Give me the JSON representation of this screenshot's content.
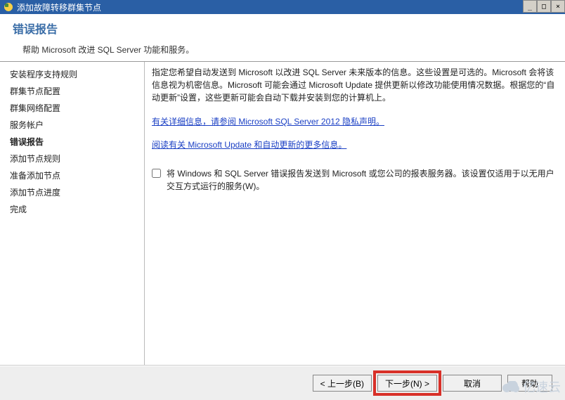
{
  "window": {
    "title": "添加故障转移群集节点",
    "minimize": "_",
    "maximize": "□",
    "close": "×"
  },
  "header": {
    "title": "错误报告",
    "subtitle": "帮助 Microsoft 改进 SQL Server 功能和服务。"
  },
  "sidebar": {
    "items": [
      {
        "label": "安装程序支持规则",
        "active": false
      },
      {
        "label": "群集节点配置",
        "active": false
      },
      {
        "label": "群集网络配置",
        "active": false
      },
      {
        "label": "服务帐户",
        "active": false
      },
      {
        "label": "错误报告",
        "active": true
      },
      {
        "label": "添加节点规则",
        "active": false
      },
      {
        "label": "准备添加节点",
        "active": false
      },
      {
        "label": "添加节点进度",
        "active": false
      },
      {
        "label": "完成",
        "active": false
      }
    ]
  },
  "main": {
    "description": "指定您希望自动发送到 Microsoft 以改进 SQL Server 未来版本的信息。这些设置是可选的。Microsoft 会将该信息视为机密信息。Microsoft 可能会通过 Microsoft Update 提供更新以修改功能使用情况数据。根据您的“自动更新”设置，这些更新可能会自动下载并安装到您的计算机上。",
    "link1": "有关详细信息，请参阅 Microsoft SQL Server 2012 隐私声明。",
    "link2": "阅读有关 Microsoft Update 和自动更新的更多信息。",
    "checkbox_label": "将 Windows 和 SQL Server 错误报告发送到 Microsoft 或您公司的报表服务器。该设置仅适用于以无用户交互方式运行的服务(W)。",
    "checkbox_checked": false
  },
  "footer": {
    "back": "< 上一步(B)",
    "next": "下一步(N) >",
    "cancel": "取消",
    "help": "帮助"
  },
  "watermark": "亿速云"
}
